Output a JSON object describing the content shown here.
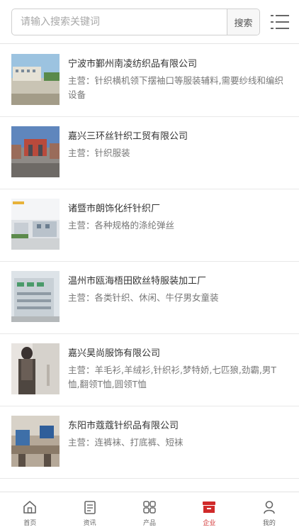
{
  "search": {
    "placeholder": "请输入搜索关键词",
    "button_label": "搜索"
  },
  "companies": [
    {
      "name": "宁波市鄞州南凌纺织品有限公司",
      "business": "主营：针织横机领下摆袖口等服装辅料,需要纱线和编织设备"
    },
    {
      "name": "嘉兴三环丝针织工贸有限公司",
      "business": "主营：针织服装"
    },
    {
      "name": "诸暨市朗饰化纤针织厂",
      "business": "主营：各种规格的涤纶弹丝"
    },
    {
      "name": "温州市瓯海梧田欧丝特服装加工厂",
      "business": "主营：各类针织、休闲、牛仔男女童装"
    },
    {
      "name": "嘉兴昊尚服饰有限公司",
      "business": "主营：羊毛衫,羊绒衫,针织衫,梦特娇,七匹狼,劲霸,男T恤,翻领T恤,圆领T恤"
    },
    {
      "name": "东阳市蔻蔻针织品有限公司",
      "business": "主营：连裤袜、打底裤、短袜"
    }
  ],
  "tabs": [
    {
      "label": "首页",
      "icon": "home-icon"
    },
    {
      "label": "资讯",
      "icon": "news-icon"
    },
    {
      "label": "产品",
      "icon": "grid-icon"
    },
    {
      "label": "企业",
      "icon": "shop-icon",
      "active": true
    },
    {
      "label": "我的",
      "icon": "user-icon"
    }
  ],
  "colors": {
    "active": "#d02a2a",
    "text": "#333333",
    "muted": "#777777"
  }
}
